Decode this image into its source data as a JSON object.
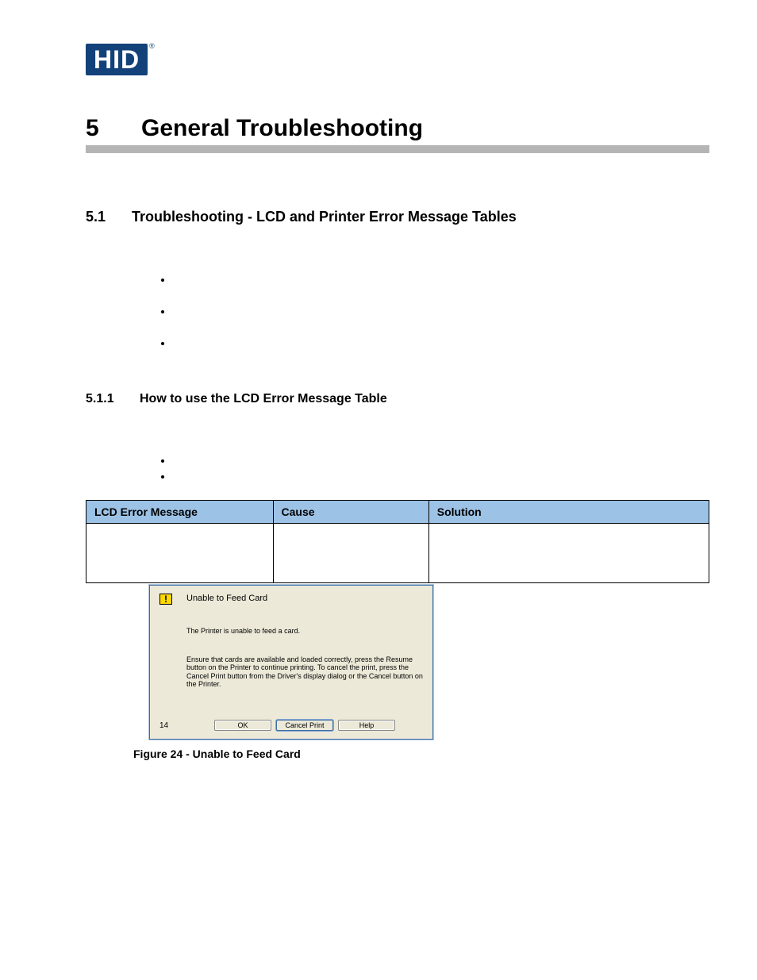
{
  "logo": {
    "text": "HID",
    "reg": "®"
  },
  "chapter": {
    "num": "5",
    "title": "General Troubleshooting"
  },
  "section": {
    "num": "5.1",
    "title": "Troubleshooting - LCD and Printer Error Message Tables"
  },
  "subsection": {
    "num": "5.1.1",
    "title": "How to use the LCD Error Message Table"
  },
  "table": {
    "headers": [
      "LCD Error Message",
      "Cause",
      "Solution"
    ],
    "rows": [
      [
        "",
        "",
        ""
      ]
    ]
  },
  "dialog": {
    "icon_glyph": "!",
    "title": "Unable to Feed Card",
    "message": "The Printer is unable to feed a card.",
    "help": "Ensure that cards are available and loaded correctly, press the Resume button on the Printer to continue printing. To cancel the print, press the Cancel Print button from the Driver's display dialog or the Cancel button on the Printer.",
    "count": "14",
    "buttons": {
      "ok": "OK",
      "cancel": "Cancel Print",
      "help": "Help"
    }
  },
  "caption": "Figure 24 - Unable to Feed Card"
}
